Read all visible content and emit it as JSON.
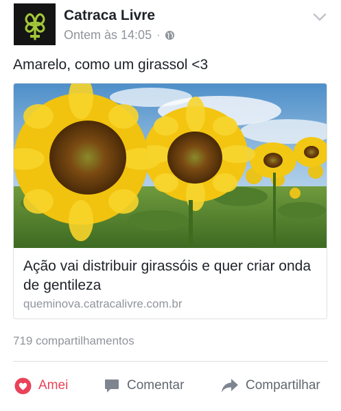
{
  "post": {
    "page_name": "Catraca Livre",
    "timestamp": "Ontem às 14:05",
    "separator": "·",
    "privacy_icon": "globe-icon",
    "menu_icon": "chevron-down-icon",
    "caption": "Amarelo, como um girassol <3"
  },
  "link_card": {
    "image": "sunflower-field-photo",
    "title": "Ação vai distribuir girassóis e quer criar onda de gentileza",
    "domain": "queminova.catracalivre.com.br"
  },
  "engagement": {
    "shares_text": "719 compartilhamentos"
  },
  "actions": {
    "love_label": "Amei",
    "comment_label": "Comentar",
    "share_label": "Compartilhar"
  },
  "colors": {
    "love": "#e9425a",
    "muted": "#90949c",
    "text": "#1d2129",
    "logo_green": "#a3c73a"
  }
}
